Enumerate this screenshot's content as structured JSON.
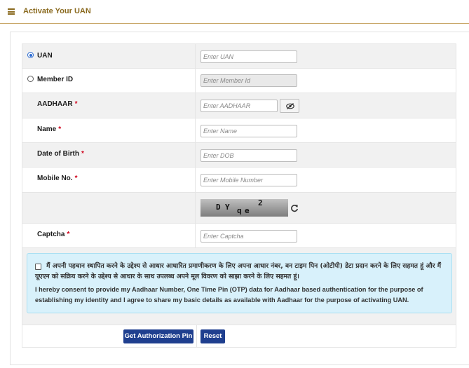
{
  "header": {
    "title": "Activate Your UAN",
    "menu_icon": "hamburger-menu-icon"
  },
  "form": {
    "uan": {
      "label": "UAN",
      "placeholder": "Enter UAN",
      "selected": true
    },
    "member_id": {
      "label": "Member ID",
      "placeholder": "Enter Member Id",
      "selected": false
    },
    "aadhaar": {
      "label": "AADHAAR",
      "placeholder": "Enter AADHAAR"
    },
    "name": {
      "label": "Name",
      "placeholder": "Enter Name"
    },
    "dob": {
      "label": "Date of Birth",
      "placeholder": "Enter DOB"
    },
    "mobile": {
      "label": "Mobile No.",
      "placeholder": "Enter Mobile Number"
    },
    "captcha_image": {
      "chars": [
        "D",
        "Y",
        "q",
        "e",
        "2"
      ]
    },
    "captcha": {
      "label": "Captcha",
      "placeholder": "Enter Captcha"
    },
    "required_marker": "*"
  },
  "consent": {
    "hindi": "मैं अपनी पहचान स्थापित करने के उद्देश्य से आधार आधारित प्रमाणीकरण के लिए अपना आधार नंबर, वन टाइम पिन (ओटीपी) डेटा प्रदान करने के लिए सहमत हूं और मैं यूएएन को सक्रिय करने के उद्देश्य से आधार के साथ उपलब्ध अपने मूल विवरण को साझा करने के लिए सहमत हूं।",
    "english": "I hereby consent to provide my Aadhaar Number, One Time Pin (OTP) data for Aadhaar based authentication for the purpose of establishing my identity and I agree to share my basic details as available with Aadhaar for the purpose of activating UAN.",
    "checked": false
  },
  "buttons": {
    "get_pin": "Get Authorization Pin",
    "reset": "Reset"
  },
  "colors": {
    "header_text": "#8a6a1f",
    "button_bg": "#1f3f8f",
    "consent_bg": "#d8f1fb",
    "required": "#d0021b"
  }
}
